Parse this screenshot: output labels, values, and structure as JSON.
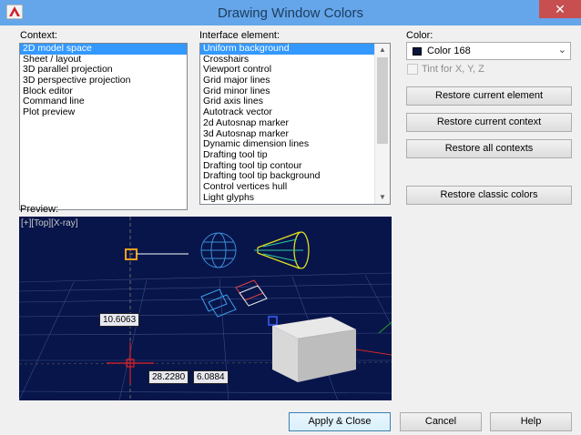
{
  "window": {
    "title": "Drawing Window Colors",
    "close_glyph": "✕",
    "app_icon": "autocad-logo-icon"
  },
  "context": {
    "label": "Context:",
    "items": [
      "2D model space",
      "Sheet / layout",
      "3D parallel projection",
      "3D perspective projection",
      "Block editor",
      "Command line",
      "Plot preview"
    ],
    "selected": "2D model space"
  },
  "interface": {
    "label": "Interface element:",
    "items": [
      "Uniform background",
      "Crosshairs",
      "Viewport control",
      "Grid major lines",
      "Grid minor lines",
      "Grid axis lines",
      "Autotrack vector",
      "2d Autosnap marker",
      "3d Autosnap marker",
      "Dynamic dimension lines",
      "Drafting tool tip",
      "Drafting tool tip contour",
      "Drafting tool tip background",
      "Control vertices hull",
      "Light glyphs"
    ],
    "selected": "Uniform background"
  },
  "color": {
    "label": "Color:",
    "value": "Color 168",
    "swatch": "#07163f",
    "tint_label": "Tint for X, Y, Z",
    "tint_checked": false,
    "tint_enabled": false
  },
  "buttons": {
    "restore_element": "Restore current element",
    "restore_context": "Restore current context",
    "restore_all": "Restore all contexts",
    "restore_classic": "Restore classic colors",
    "apply": "Apply & Close",
    "cancel": "Cancel",
    "help": "Help"
  },
  "preview": {
    "label": "Preview:",
    "viewport_label": "[+][Top][X-ray]",
    "dim1": "10.6063",
    "dim2": "28.2280",
    "dim3": "6.0884",
    "background": "#08154a"
  }
}
